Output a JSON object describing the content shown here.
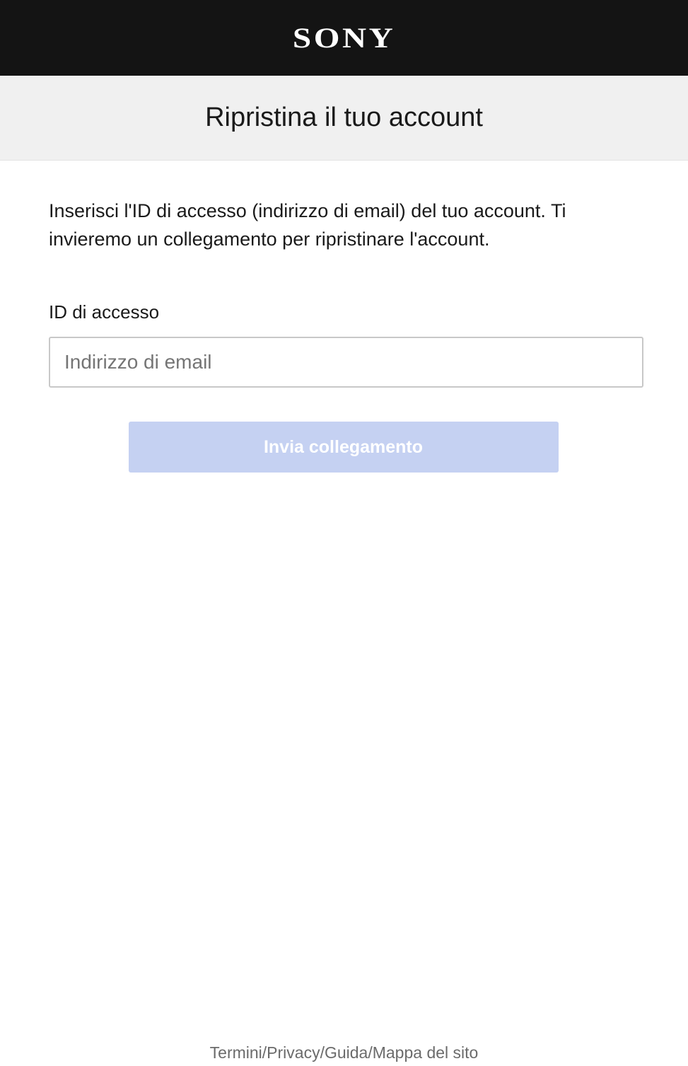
{
  "header": {
    "logo_text": "SONY"
  },
  "title_band": {
    "title": "Ripristina il tuo account"
  },
  "form": {
    "intro_text": "Inserisci l'ID di accesso (indirizzo di email) del tuo account. Ti invieremo un collegamento per ripristinare l'account.",
    "field_label": "ID di accesso",
    "email_value": "",
    "email_placeholder": "Indirizzo di email",
    "submit_label": "Invia collegamento",
    "submit_enabled": false
  },
  "footer": {
    "links": [
      "Termini",
      "Privacy",
      "Guida",
      "Mappa del sito"
    ],
    "separator": "/"
  },
  "colors": {
    "topbar_bg": "#141414",
    "title_band_bg": "#f0f0f0",
    "button_disabled_bg": "#c5d1f2",
    "footer_text": "#6b6b6b"
  }
}
